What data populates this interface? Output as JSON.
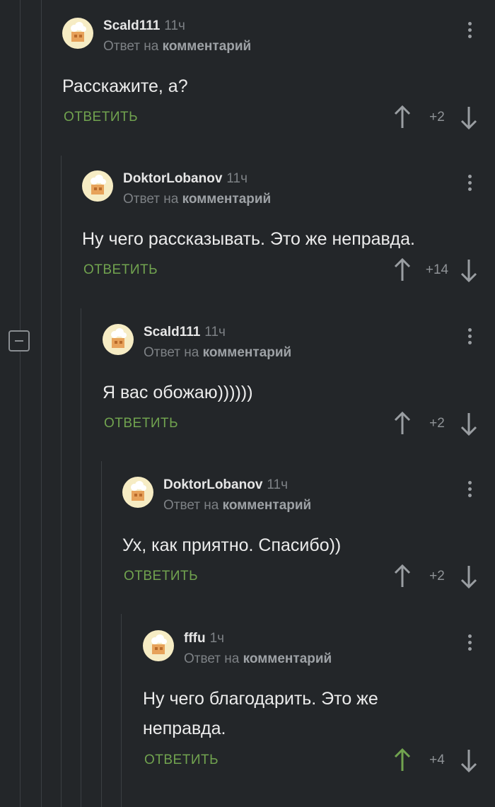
{
  "colors": {
    "background": "#232629",
    "accent_green": "#71a34f",
    "muted_text": "#7d8185",
    "thread_line": "#3b3f43"
  },
  "comments": [
    {
      "author": "Scald111",
      "time": "11ч",
      "reply_prefix": "Ответ на",
      "reply_target": "комментарий",
      "text": "Расскажите, а?",
      "reply_label": "ОТВЕТИТЬ",
      "score": "+2",
      "upvoted": false
    },
    {
      "author": "DoktorLobanov",
      "time": "11ч",
      "reply_prefix": "Ответ на",
      "reply_target": "комментарий",
      "text": "Ну чего рассказывать. Это же неправда.",
      "reply_label": "ОТВЕТИТЬ",
      "score": "+14",
      "upvoted": false
    },
    {
      "author": "Scald111",
      "time": "11ч",
      "reply_prefix": "Ответ на",
      "reply_target": "комментарий",
      "text": "Я вас обожаю))))))",
      "reply_label": "ОТВЕТИТЬ",
      "score": "+2",
      "upvoted": false
    },
    {
      "author": "DoktorLobanov",
      "time": "11ч",
      "reply_prefix": "Ответ на",
      "reply_target": "комментарий",
      "text": "Ух, как приятно. Спасибо))",
      "reply_label": "ОТВЕТИТЬ",
      "score": "+2",
      "upvoted": false
    },
    {
      "author": "fffu",
      "time": "1ч",
      "reply_prefix": "Ответ на",
      "reply_target": "комментарий",
      "text": "Ну чего благодарить. Это же неправда.",
      "reply_label": "ОТВЕТИТЬ",
      "score": "+4",
      "upvoted": true
    }
  ]
}
